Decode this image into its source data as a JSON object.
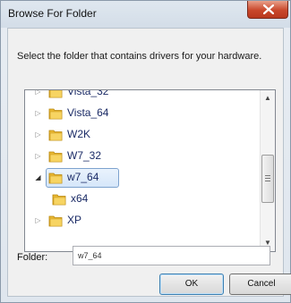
{
  "window": {
    "title": "Browse For Folder"
  },
  "dialog": {
    "instruction": "Select the folder that contains drivers for your hardware.",
    "tree": {
      "items": [
        {
          "label": "Vista_32",
          "expander": "collapsed",
          "selected": false,
          "indent": 0
        },
        {
          "label": "Vista_64",
          "expander": "collapsed",
          "selected": false,
          "indent": 0
        },
        {
          "label": "W2K",
          "expander": "collapsed",
          "selected": false,
          "indent": 0
        },
        {
          "label": "W7_32",
          "expander": "collapsed",
          "selected": false,
          "indent": 0
        },
        {
          "label": "w7_64",
          "expander": "expanded",
          "selected": true,
          "indent": 0
        },
        {
          "label": "x64",
          "expander": "none",
          "selected": false,
          "indent": 1
        },
        {
          "label": "XP",
          "expander": "collapsed",
          "selected": false,
          "indent": 0
        }
      ]
    },
    "folder_label": "Folder:",
    "folder_value": "w7_64",
    "ok_label": "OK",
    "cancel_label": "Cancel"
  },
  "icons": {
    "close": "close-icon",
    "folder": "folder-icon",
    "expand": "chevron-right-icon",
    "collapse": "triangle-down-icon",
    "scroll_up": "scroll-up-arrow-icon",
    "scroll_down": "scroll-down-arrow-icon"
  },
  "colors": {
    "close_button": "#c9482b",
    "folder": "#e8b732",
    "selection": "#d5e6f9",
    "tree_text": "#1b2b66"
  }
}
